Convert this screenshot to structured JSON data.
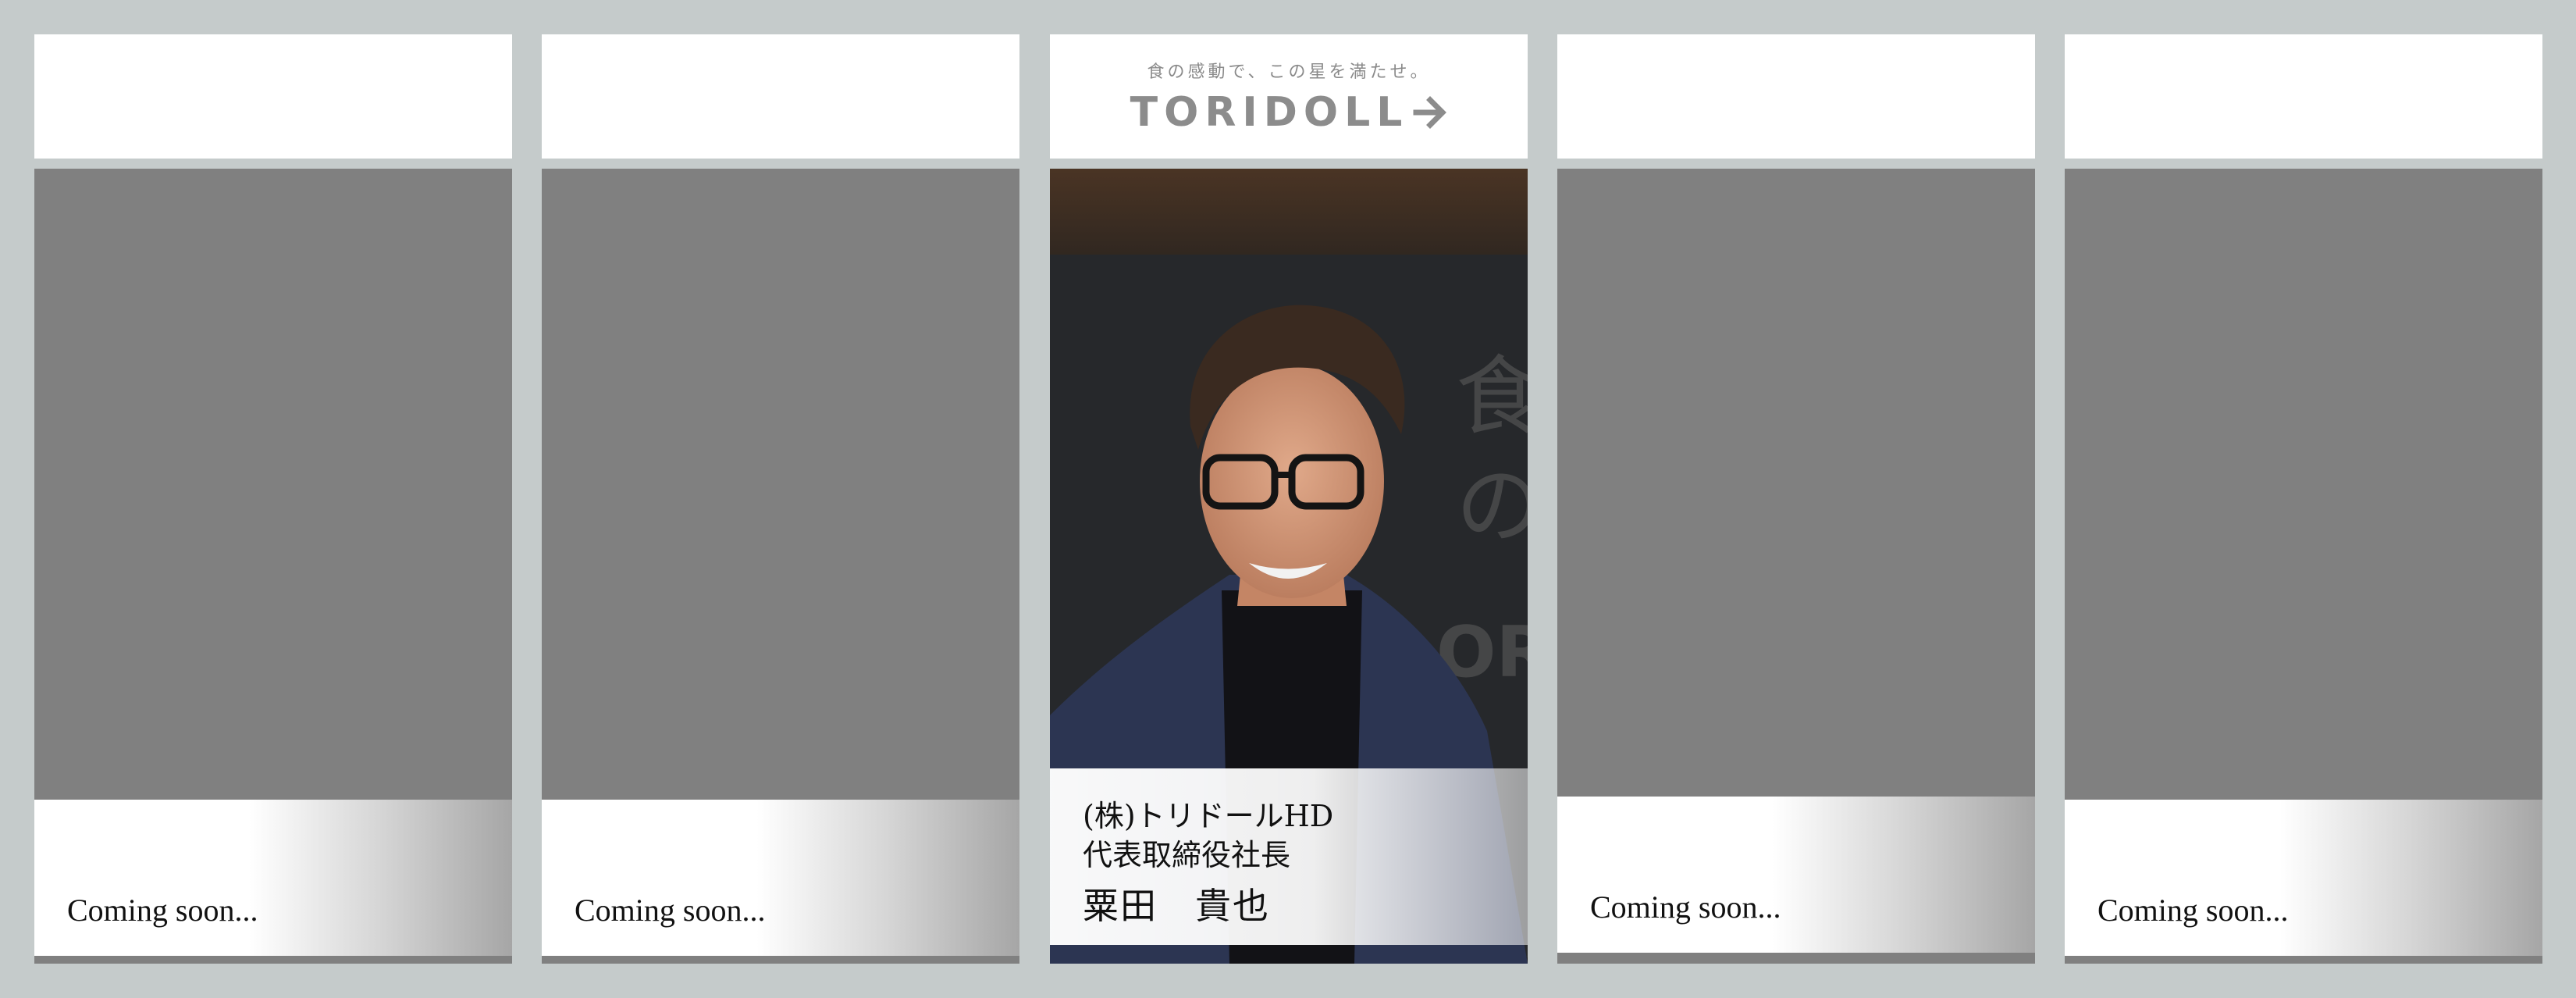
{
  "panels": [
    {
      "caption": "Coming soon..."
    },
    {
      "caption": "Coming soon..."
    },
    {
      "tagline": "食の感動で、この星を満たせ。",
      "logo_text": "TORIDOLL",
      "logo_icon": "arrow-right-icon",
      "company": "(株)トリドールHD",
      "title": "代表取締役社長",
      "name": "粟田　貴也"
    },
    {
      "caption": "Coming soon..."
    },
    {
      "caption": "Coming soon..."
    }
  ],
  "colors": {
    "background": "#c5cbcb",
    "placeholder": "#808080",
    "logo": "#8c8c8c"
  }
}
